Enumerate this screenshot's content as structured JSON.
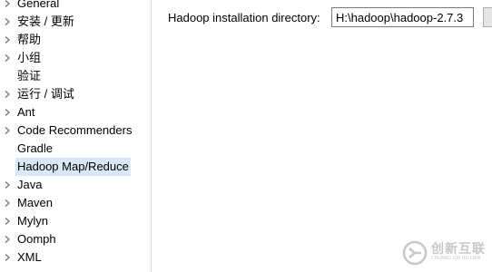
{
  "tree": {
    "items": [
      {
        "label": "General",
        "expandable": true,
        "selected": false
      },
      {
        "label": "安装 / 更新",
        "expandable": true,
        "selected": false
      },
      {
        "label": "帮助",
        "expandable": true,
        "selected": false
      },
      {
        "label": "小组",
        "expandable": true,
        "selected": false
      },
      {
        "label": "验证",
        "expandable": false,
        "selected": false
      },
      {
        "label": "运行 / 调试",
        "expandable": true,
        "selected": false
      },
      {
        "label": "Ant",
        "expandable": true,
        "selected": false
      },
      {
        "label": "Code Recommenders",
        "expandable": true,
        "selected": false
      },
      {
        "label": "Gradle",
        "expandable": false,
        "selected": false
      },
      {
        "label": "Hadoop Map/Reduce",
        "expandable": false,
        "selected": true
      },
      {
        "label": "Java",
        "expandable": true,
        "selected": false
      },
      {
        "label": "Maven",
        "expandable": true,
        "selected": false
      },
      {
        "label": "Mylyn",
        "expandable": true,
        "selected": false
      },
      {
        "label": "Oomph",
        "expandable": true,
        "selected": false
      },
      {
        "label": "XML",
        "expandable": true,
        "selected": false
      }
    ]
  },
  "panel": {
    "dir_label": "Hadoop installation directory:",
    "dir_value": "H:\\hadoop\\hadoop-2.7.3"
  },
  "watermark": {
    "text": "创新互联",
    "subtext": "CHUANG XIN HU LIAN"
  },
  "colors": {
    "selection": "#d9e8f7",
    "divider": "#d6d6d6",
    "chevron": "#6e6e6e"
  }
}
